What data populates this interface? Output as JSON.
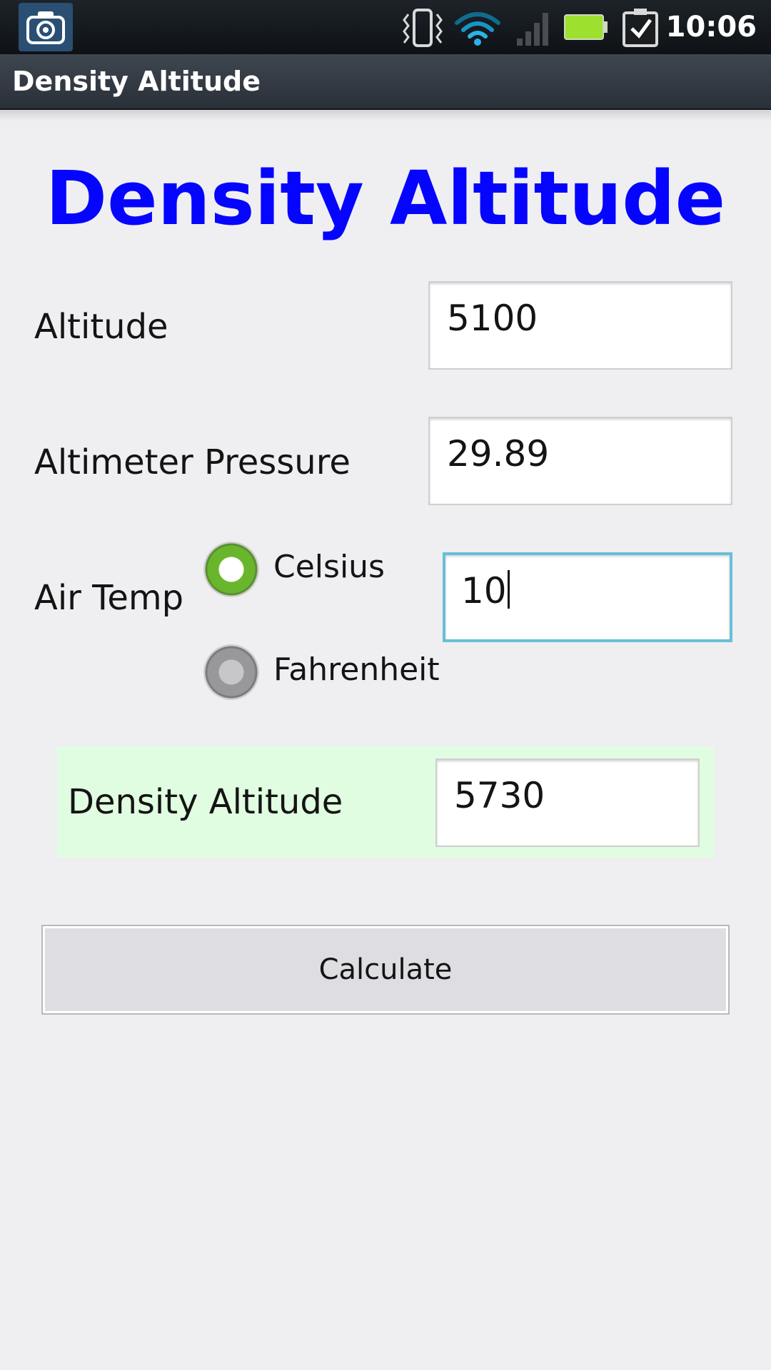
{
  "status_bar": {
    "time": "10:06",
    "icons": [
      "camera-icon",
      "vibrate-icon",
      "wifi-icon",
      "signal-icon",
      "battery-icon",
      "task-check-icon"
    ],
    "battery_color": "#9ee02f"
  },
  "app_bar": {
    "title": "Density Altitude"
  },
  "main": {
    "heading": "Density Altitude",
    "heading_color": "#0505ff",
    "altitude": {
      "label": "Altitude",
      "value": "5100"
    },
    "pressure": {
      "label": "Altimeter Pressure",
      "value": "29.89"
    },
    "air_temp": {
      "label": "Air Temp",
      "value": "10",
      "units": [
        {
          "label": "Celsius",
          "selected": true
        },
        {
          "label": "Fahrenheit",
          "selected": false
        }
      ]
    },
    "result": {
      "label": "Density Altitude",
      "value": "5730",
      "background": "#e1fde1"
    },
    "calculate_label": "Calculate"
  }
}
